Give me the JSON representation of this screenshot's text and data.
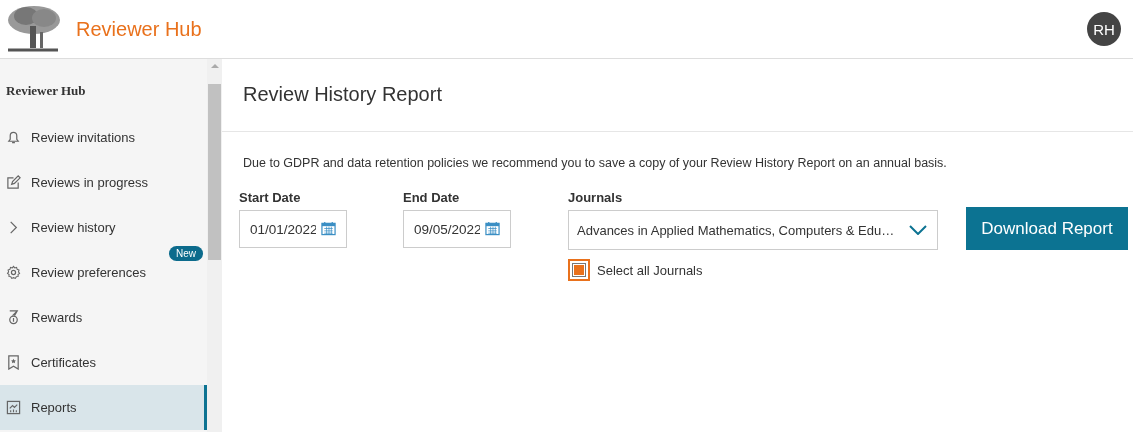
{
  "header": {
    "title": "Reviewer Hub",
    "avatar": "RH"
  },
  "sidebar": {
    "heading": "Reviewer Hub",
    "items": [
      {
        "label": "Review invitations",
        "selected": false
      },
      {
        "label": "Reviews in progress",
        "selected": false
      },
      {
        "label": "Review history",
        "selected": false
      },
      {
        "label": "Review preferences",
        "selected": false,
        "badge": "New"
      },
      {
        "label": "Rewards",
        "selected": false
      },
      {
        "label": "Certificates",
        "selected": false
      },
      {
        "label": "Reports",
        "selected": true
      }
    ]
  },
  "page": {
    "title": "Review History Report",
    "notice": "Due to GDPR and data retention policies we recommend you to save a copy of your Review History Report on an annual basis.",
    "start_date": {
      "label": "Start Date",
      "value": "01/01/2022"
    },
    "end_date": {
      "label": "End Date",
      "value": "09/05/2022"
    },
    "journals": {
      "label": "Journals",
      "value": "Advances in Applied Mathematics, Computers & Edu…"
    },
    "select_all": {
      "label": "Select all Journals",
      "checked": true
    },
    "download_button": "Download Report"
  }
}
